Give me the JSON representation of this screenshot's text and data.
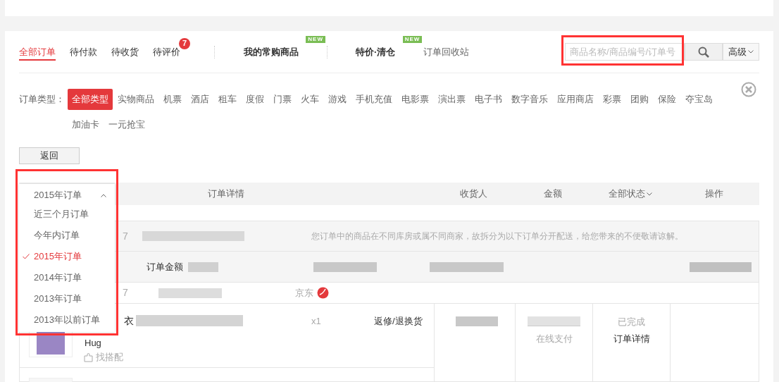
{
  "tabs": [
    {
      "label": "全部订单",
      "selected": true
    },
    {
      "label": "待付款",
      "selected": false
    },
    {
      "label": "待收货",
      "selected": false
    },
    {
      "label": "待评价",
      "selected": false,
      "badge": "7"
    }
  ],
  "features": [
    {
      "label": "我的常购商品",
      "tag": "NEW"
    },
    {
      "label": "特价·清仓",
      "tag": "NEW"
    }
  ],
  "recycle_link": "订单回收站",
  "search": {
    "placeholder": "商品名称/商品编号/订单号",
    "advanced": "高级"
  },
  "order_types": {
    "label": "订单类型：",
    "items": [
      {
        "label": "全部类型",
        "selected": true
      },
      {
        "label": "实物商品",
        "selected": false
      },
      {
        "label": "机票",
        "selected": false
      },
      {
        "label": "酒店",
        "selected": false
      },
      {
        "label": "租车",
        "selected": false
      },
      {
        "label": "度假",
        "selected": false
      },
      {
        "label": "门票",
        "selected": false
      },
      {
        "label": "火车",
        "selected": false
      },
      {
        "label": "游戏",
        "selected": false
      },
      {
        "label": "手机充值",
        "selected": false
      },
      {
        "label": "电影票",
        "selected": false
      },
      {
        "label": "演出票",
        "selected": false
      },
      {
        "label": "电子书",
        "selected": false
      },
      {
        "label": "数字音乐",
        "selected": false
      },
      {
        "label": "应用商店",
        "selected": false
      },
      {
        "label": "彩票",
        "selected": false
      },
      {
        "label": "团购",
        "selected": false
      },
      {
        "label": "保险",
        "selected": false
      },
      {
        "label": "夺宝岛",
        "selected": false
      },
      {
        "label": "加油卡",
        "selected": false
      },
      {
        "label": "一元抢宝",
        "selected": false
      }
    ]
  },
  "back_button": "返回",
  "year_dropdown": {
    "current": "2015年订单",
    "options": [
      {
        "label": "近三个月订单",
        "selected": false
      },
      {
        "label": "今年内订单",
        "selected": false
      },
      {
        "label": "2015年订单",
        "selected": true
      },
      {
        "label": "2014年订单",
        "selected": false
      },
      {
        "label": "2013年订单",
        "selected": false
      },
      {
        "label": "2013年以前订单",
        "selected": false
      }
    ]
  },
  "table": {
    "columns": [
      "订单详情",
      "收货人",
      "金额",
      "全部状态",
      "操作"
    ]
  },
  "order_group": {
    "id_fragment": "7",
    "notice": "您订单中的商品在不同库房或属不同商家，故拆分为以下订单分开配送，给您带来的不便敬请谅解。",
    "amount_label": "订单金额",
    "sub_order": {
      "id_fragment": "7",
      "shop": "京东"
    },
    "items": [
      {
        "name_fragment": "衣",
        "name_line2": "Hug",
        "quantity": "x1",
        "service": "返修/退换货",
        "match": "找搭配"
      }
    ],
    "payment": "在线支付",
    "status": "已完成",
    "detail_link": "订单详情"
  }
}
